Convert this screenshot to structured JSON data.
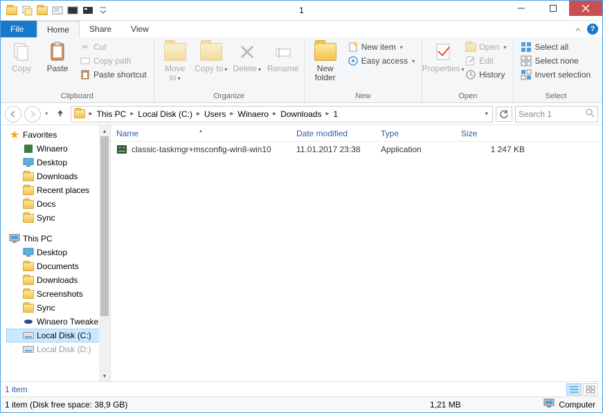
{
  "window": {
    "title": "1"
  },
  "tabs": {
    "file": "File",
    "home": "Home",
    "share": "Share",
    "view": "View"
  },
  "ribbon": {
    "clipboard": {
      "label": "Clipboard",
      "copy": "Copy",
      "paste": "Paste",
      "cut": "Cut",
      "copy_path": "Copy path",
      "paste_shortcut": "Paste shortcut"
    },
    "organize": {
      "label": "Organize",
      "move_to": "Move to",
      "copy_to": "Copy to",
      "delete": "Delete",
      "rename": "Rename"
    },
    "new": {
      "label": "New",
      "new_folder": "New folder",
      "new_item": "New item",
      "easy_access": "Easy access"
    },
    "open": {
      "label": "Open",
      "properties": "Properties",
      "open": "Open",
      "edit": "Edit",
      "history": "History"
    },
    "select": {
      "label": "Select",
      "select_all": "Select all",
      "select_none": "Select none",
      "invert": "Invert selection"
    }
  },
  "breadcrumbs": [
    "This PC",
    "Local Disk (C:)",
    "Users",
    "Winaero",
    "Downloads",
    "1"
  ],
  "search": {
    "placeholder": "Search 1"
  },
  "nav": {
    "favorites": "Favorites",
    "fav_items": [
      "Winaero",
      "Desktop",
      "Downloads",
      "Recent places",
      "Docs",
      "Sync"
    ],
    "this_pc": "This PC",
    "pc_items": [
      "Desktop",
      "Documents",
      "Downloads",
      "Screenshots",
      "Sync",
      "Winaero Tweaker",
      "Local Disk (C:)",
      "Local Disk (D:)"
    ]
  },
  "columns": {
    "name": "Name",
    "date": "Date modified",
    "type": "Type",
    "size": "Size"
  },
  "files": [
    {
      "name": "classic-taskmgr+msconfig-win8-win10",
      "date": "11.01.2017 23:38",
      "type": "Application",
      "size": "1 247 KB"
    }
  ],
  "status": {
    "item_count": "1 item",
    "disk_free": "1 item (Disk free space: 38,9 GB)",
    "selection_size": "1,21 MB",
    "computer": "Computer"
  }
}
